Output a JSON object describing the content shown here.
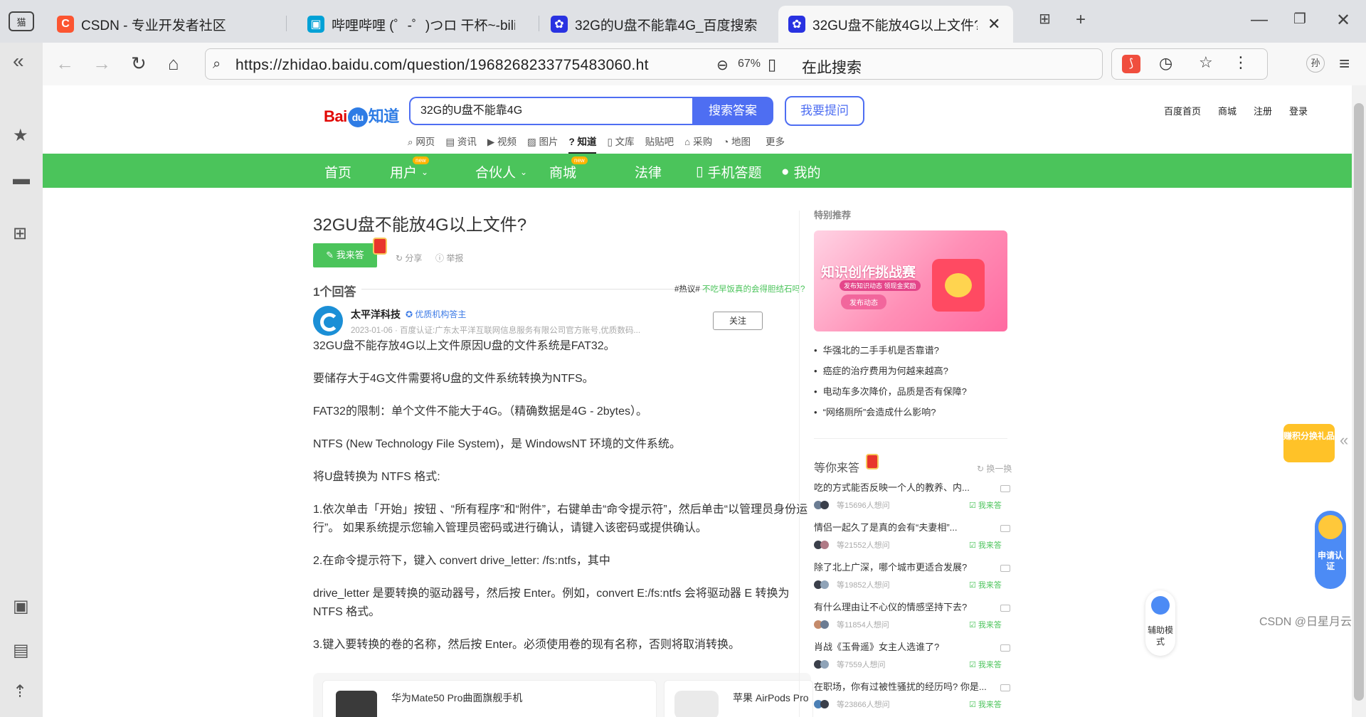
{
  "browser": {
    "tabs": [
      {
        "title": "CSDN - 专业开发者社区",
        "favicon": "csdn-icon",
        "favicon_color": "#fc5531"
      },
      {
        "title": "哔哩哔哩 (゜-゜)つロ 干杯~-bili",
        "favicon": "bilibili-icon",
        "favicon_color": "#00a1d6"
      },
      {
        "title": "32G的U盘不能靠4G_百度搜索",
        "favicon": "baidu-paw-icon",
        "favicon_color": "#2932e1"
      },
      {
        "title": "32GU盘不能放4G以上文件? _",
        "favicon": "baidu-paw-icon",
        "favicon_color": "#2932e1"
      }
    ],
    "window_icon_label": "猫",
    "url": "https://zhidao.baidu.com/question/1968268233775483060.ht",
    "zoom": "67%",
    "search_placeholder": "在此搜索",
    "profile_label": "孙"
  },
  "site": {
    "logo": {
      "bai": "Bai",
      "du": "du",
      "zhidao": "知道"
    },
    "search_value": "32G的U盘不能靠4G",
    "search_button": "搜索答案",
    "ask_button": "我要提问",
    "top_links": [
      "百度首页",
      "商城",
      "注册",
      "登录"
    ],
    "sub_nav": [
      "网页",
      "资讯",
      "视频",
      "图片",
      "知道",
      "文库",
      "贴贴吧",
      "采购",
      "地图",
      "更多"
    ],
    "sub_nav_active": "知道",
    "green_nav": [
      "首页",
      "用户",
      "合伙人",
      "商城",
      "法律",
      "手机答题",
      "我的"
    ],
    "new_tag": "new"
  },
  "question": {
    "title": "32GU盘不能放4G以上文件?",
    "answer_button": "我来答",
    "share": "分享",
    "report": "举报",
    "answer_count": "1个回答",
    "hot_prefix": "#热议#",
    "hot_link": "不吃早饭真的会得胆结石吗?"
  },
  "answer": {
    "author": "太平洋科技",
    "badge": "优质机构答主",
    "meta": "2023-01-06 · 百度认证:广东太平洋互联网信息服务有限公司官方账号,优质数码...",
    "follow": "关注",
    "paragraphs": [
      "32GU盘不能存放4G以上文件原因U盘的文件系统是FAT32。",
      "要储存大于4G文件需要将U盘的文件系统转换为NTFS。",
      "FAT32的限制：单个文件不能大于4G。（精确数据是4G - 2bytes）。",
      "NTFS (New Technology File System)，是 WindowsNT 环境的文件系统。",
      "将U盘转换为 NTFS 格式:",
      "1.依次单击「开始」按钮 、“所有程序”和“附件”，右键单击“命令提示符”，然后单击“以管理员身份运行”。 如果系统提示您输入管理员密码或进行确认，请键入该密码或提供确认。",
      "2.在命令提示符下，键入 convert drive_letter: /fs:ntfs，其中",
      "drive_letter 是要转换的驱动器号，然后按 Enter。例如，convert E:/fs:ntfs 会将驱动器 E 转换为 NTFS 格式。",
      "3.键入要转换的卷的名称，然后按 Enter。必须使用卷的现有名称，否则将取消转换。"
    ],
    "products": [
      "华为Mate50 Pro曲面旗舰手机",
      "苹果 AirPods Pro"
    ]
  },
  "right": {
    "special_head": "特别推荐",
    "banner": {
      "title": "知识创作挑战赛",
      "sub": "发布知识动态 领现金奖励",
      "btn": "发布动态"
    },
    "recommend": [
      "华强北的二手手机是否靠谱?",
      "癌症的治疗费用为何越来越高?",
      "电动车多次降价，品质是否有保障?",
      "“网络厕所”会造成什么影响?"
    ],
    "wait_head": "等你来答",
    "swap": "换一换",
    "wait_items": [
      {
        "q": "吃的方式能否反映一个人的教养、内...",
        "count": "等15696人想问",
        "go": "我来答"
      },
      {
        "q": "情侣一起久了是真的会有“夫妻相”...",
        "count": "等21552人想问",
        "go": "我来答"
      },
      {
        "q": "除了北上广深，哪个城市更适合发展?",
        "count": "等19852人想问",
        "go": "我来答"
      },
      {
        "q": "有什么理由让不心仪的情感坚持下去?",
        "count": "等11854人想问",
        "go": "我来答"
      },
      {
        "q": "肖战《玉骨遥》女主人选谁了?",
        "count": "等7559人想问",
        "go": "我来答"
      },
      {
        "q": "在职场，你有过被性骚扰的经历吗? 你是...",
        "count": "等23866人想问",
        "go": "我来答"
      }
    ],
    "float_points": "赚积分换礼品",
    "float_apply": "申请认证",
    "float_assist": "辅助模式"
  },
  "watermark": "CSDN @日星月云",
  "colors": {
    "green": "#4bc45b",
    "baidu_blue": "#4e6ef2",
    "baidu_red": "#e10602"
  }
}
